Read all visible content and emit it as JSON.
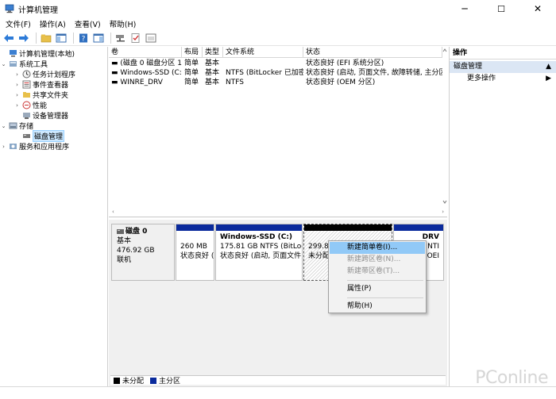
{
  "window": {
    "title": "计算机管理",
    "min": "─",
    "max": "☐",
    "close": "✕"
  },
  "menu": [
    "文件(F)",
    "操作(A)",
    "查看(V)",
    "帮助(H)"
  ],
  "tree": {
    "root": "计算机管理(本地)",
    "system_tools": "系统工具",
    "task_scheduler": "任务计划程序",
    "event_viewer": "事件查看器",
    "shared_folders": "共享文件夹",
    "performance": "性能",
    "device_manager": "设备管理器",
    "storage": "存储",
    "disk_management": "磁盘管理",
    "services": "服务和应用程序"
  },
  "table": {
    "headers": [
      "卷",
      "布局",
      "类型",
      "文件系统",
      "状态"
    ],
    "rows": [
      [
        "(磁盘 0 磁盘分区 1)",
        "简单",
        "基本",
        "",
        "状态良好 (EFI 系统分区)"
      ],
      [
        "Windows-SSD (C:)",
        "简单",
        "基本",
        "NTFS (BitLocker 已加密)",
        "状态良好 (启动, 页面文件, 故障转储, 主分区)"
      ],
      [
        "WINRE_DRV",
        "简单",
        "基本",
        "NTFS",
        "状态良好 (OEM 分区)"
      ]
    ]
  },
  "disk": {
    "name": "磁盘 0",
    "type": "基本",
    "size": "476.92 GB",
    "status": "联机",
    "partitions": [
      {
        "name": "",
        "size": "260 MB",
        "status": "状态良好 ("
      },
      {
        "name": "Windows-SSD  (C:)",
        "size": "175.81 GB NTFS (BitLocke",
        "status": "状态良好 (启动, 页面文件,"
      },
      {
        "name": "",
        "size": "299.88",
        "status": "未分配"
      },
      {
        "name": "DRV",
        "size": "NTI",
        "status": "(OEI"
      }
    ]
  },
  "legend": {
    "unallocated": "未分配",
    "primary": "主分区"
  },
  "actions": {
    "title": "操作",
    "section": "磁盘管理",
    "more": "更多操作"
  },
  "context_menu": {
    "new_simple": "新建简单卷(I)...",
    "new_spanned": "新建跨区卷(N)...",
    "new_striped": "新建带区卷(T)...",
    "properties": "属性(P)",
    "help": "帮助(H)"
  },
  "watermark": "PConline",
  "colors": {
    "primary_partition": "#0a2a9c",
    "unallocated": "#000000",
    "selection": "#cce8ff",
    "menu_highlight": "#91c9f7"
  }
}
